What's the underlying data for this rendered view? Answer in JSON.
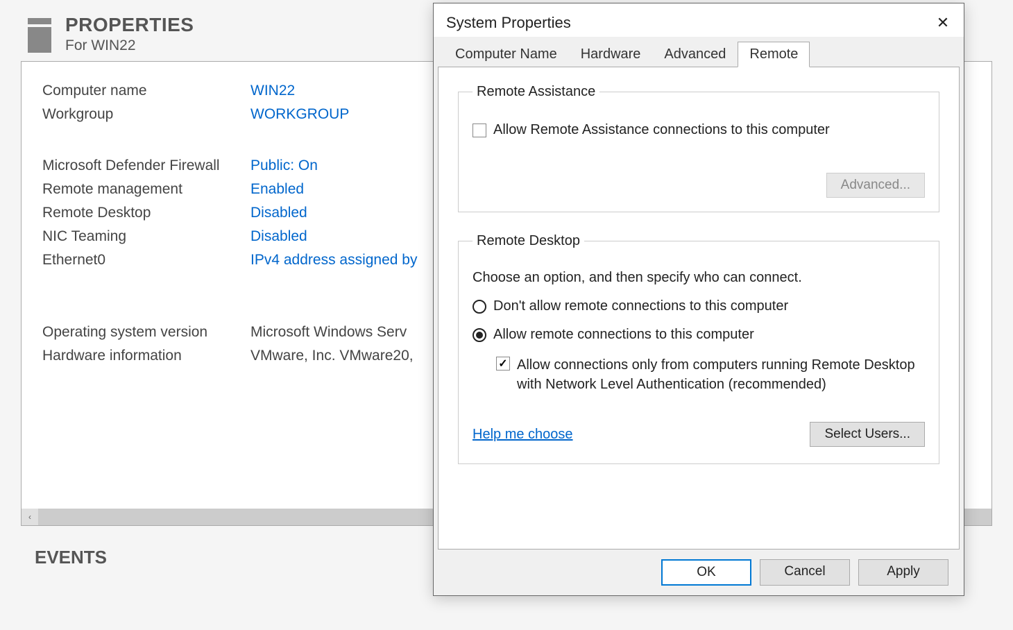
{
  "bg": {
    "title": "PROPERTIES",
    "subtitle": "For WIN22",
    "props": {
      "computer_name_label": "Computer name",
      "computer_name_value": "WIN22",
      "workgroup_label": "Workgroup",
      "workgroup_value": "WORKGROUP",
      "firewall_label": "Microsoft Defender Firewall",
      "firewall_value": "Public: On",
      "remote_mgmt_label": "Remote management",
      "remote_mgmt_value": "Enabled",
      "remote_desktop_label": "Remote Desktop",
      "remote_desktop_value": "Disabled",
      "nic_teaming_label": "NIC Teaming",
      "nic_teaming_value": "Disabled",
      "ethernet_label": "Ethernet0",
      "ethernet_value": "IPv4 address assigned by",
      "os_label": "Operating system version",
      "os_value": "Microsoft Windows Serv",
      "hw_label": "Hardware information",
      "hw_value": "VMware, Inc. VMware20,"
    },
    "events": "EVENTS"
  },
  "dialog": {
    "title": "System Properties",
    "tabs": {
      "computer_name": "Computer Name",
      "hardware": "Hardware",
      "advanced": "Advanced",
      "remote": "Remote"
    },
    "remote_assistance": {
      "legend": "Remote Assistance",
      "allow_label": "Allow Remote Assistance connections to this computer",
      "allow_checked": false,
      "advanced_btn": "Advanced..."
    },
    "remote_desktop": {
      "legend": "Remote Desktop",
      "desc": "Choose an option, and then specify who can connect.",
      "opt_deny": "Don't allow remote connections to this computer",
      "opt_allow": "Allow remote connections to this computer",
      "selected": "allow",
      "nla_label": "Allow connections only from computers running Remote Desktop with Network Level Authentication (recommended)",
      "nla_checked": true,
      "help_link": "Help me choose",
      "select_users_btn": "Select Users..."
    },
    "buttons": {
      "ok": "OK",
      "cancel": "Cancel",
      "apply": "Apply"
    }
  }
}
